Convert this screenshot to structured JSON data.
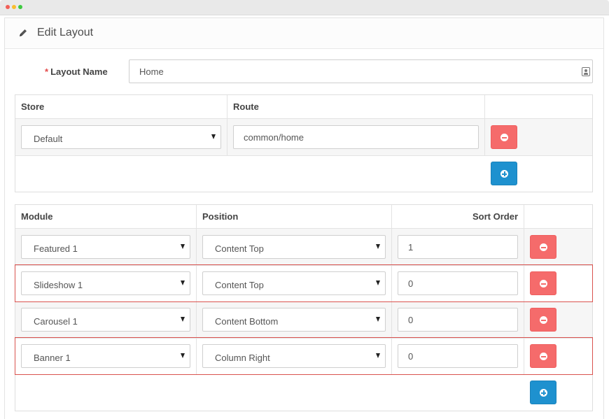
{
  "panel": {
    "title": "Edit Layout"
  },
  "layout_name": {
    "required_mark": "*",
    "label": "Layout Name",
    "value": "Home"
  },
  "routes": {
    "headers": {
      "store": "Store",
      "route": "Route"
    },
    "rows": [
      {
        "store": "Default",
        "route": "common/home"
      }
    ]
  },
  "modules": {
    "headers": {
      "module": "Module",
      "position": "Position",
      "sort_order": "Sort Order"
    },
    "rows": [
      {
        "module": "Featured 1",
        "position": "Content Top",
        "sort_order": "1",
        "highlighted": false
      },
      {
        "module": "Slideshow 1",
        "position": "Content Top",
        "sort_order": "0",
        "highlighted": true
      },
      {
        "module": "Carousel 1",
        "position": "Content Bottom",
        "sort_order": "0",
        "highlighted": false
      },
      {
        "module": "Banner 1",
        "position": "Column Right",
        "sort_order": "0",
        "highlighted": true
      }
    ]
  },
  "icons": {
    "edit": "pencil-icon",
    "layout_name_addon": "contact-card-icon",
    "remove": "minus-circle-icon",
    "add": "plus-circle-icon"
  },
  "colors": {
    "danger": "#f56b6b",
    "primary": "#1e91cf",
    "highlight_border": "#d9534f",
    "required": "#e34a4a"
  }
}
